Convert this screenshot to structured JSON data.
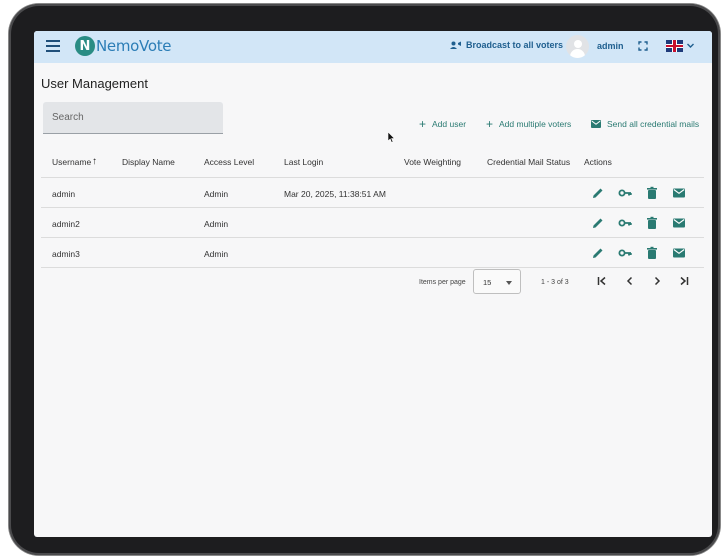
{
  "app": {
    "logo_letter": "N",
    "logo_text": "NemoVote",
    "broadcast_label": "Broadcast to all voters",
    "user_label": "admin"
  },
  "page": {
    "title": "User Management"
  },
  "search": {
    "placeholder": "Search",
    "value": ""
  },
  "actions": {
    "add_user": "Add user",
    "add_multiple": "Add multiple voters",
    "send_all_mails": "Send all credential mails"
  },
  "table": {
    "columns": [
      "Username",
      "Display Name",
      "Access Level",
      "Last Login",
      "Vote Weighting",
      "Credential Mail Status",
      "Actions"
    ],
    "sort": {
      "column": "Username",
      "direction": "ascending"
    },
    "rows": [
      {
        "username": "admin",
        "display_name": "",
        "access_level": "Admin",
        "last_login": "Mar 20, 2025, 11:38:51 AM",
        "vote_weighting": "",
        "mail_status": ""
      },
      {
        "username": "admin2",
        "display_name": "",
        "access_level": "Admin",
        "last_login": "",
        "vote_weighting": "",
        "mail_status": ""
      },
      {
        "username": "admin3",
        "display_name": "",
        "access_level": "Admin",
        "last_login": "",
        "vote_weighting": "",
        "mail_status": ""
      }
    ],
    "row_action_icons": [
      "edit-icon",
      "key-icon",
      "delete-icon",
      "mail-icon"
    ]
  },
  "pagination": {
    "items_per_page_label": "Items per page",
    "items_per_page_value": "15",
    "range_label": "1 - 3 of 3"
  },
  "colors": {
    "appbar": "#d2e6f7",
    "accent": "#2a7a72",
    "brand_blue": "#2b7db6"
  }
}
